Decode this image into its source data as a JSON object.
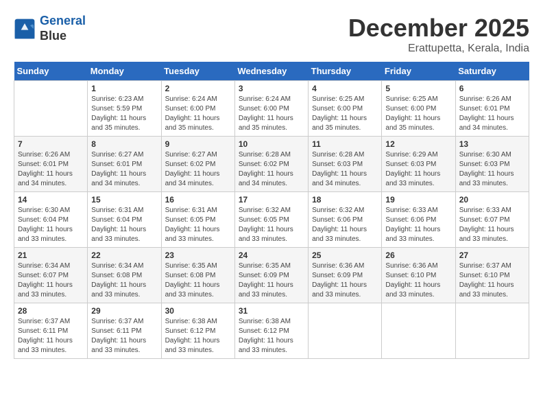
{
  "header": {
    "logo_line1": "General",
    "logo_line2": "Blue",
    "month": "December 2025",
    "location": "Erattupetta, Kerala, India"
  },
  "weekdays": [
    "Sunday",
    "Monday",
    "Tuesday",
    "Wednesday",
    "Thursday",
    "Friday",
    "Saturday"
  ],
  "weeks": [
    [
      {
        "day": "",
        "sunrise": "",
        "sunset": "",
        "daylight": ""
      },
      {
        "day": "1",
        "sunrise": "Sunrise: 6:23 AM",
        "sunset": "Sunset: 5:59 PM",
        "daylight": "Daylight: 11 hours and 35 minutes."
      },
      {
        "day": "2",
        "sunrise": "Sunrise: 6:24 AM",
        "sunset": "Sunset: 6:00 PM",
        "daylight": "Daylight: 11 hours and 35 minutes."
      },
      {
        "day": "3",
        "sunrise": "Sunrise: 6:24 AM",
        "sunset": "Sunset: 6:00 PM",
        "daylight": "Daylight: 11 hours and 35 minutes."
      },
      {
        "day": "4",
        "sunrise": "Sunrise: 6:25 AM",
        "sunset": "Sunset: 6:00 PM",
        "daylight": "Daylight: 11 hours and 35 minutes."
      },
      {
        "day": "5",
        "sunrise": "Sunrise: 6:25 AM",
        "sunset": "Sunset: 6:00 PM",
        "daylight": "Daylight: 11 hours and 35 minutes."
      },
      {
        "day": "6",
        "sunrise": "Sunrise: 6:26 AM",
        "sunset": "Sunset: 6:01 PM",
        "daylight": "Daylight: 11 hours and 34 minutes."
      }
    ],
    [
      {
        "day": "7",
        "sunrise": "Sunrise: 6:26 AM",
        "sunset": "Sunset: 6:01 PM",
        "daylight": "Daylight: 11 hours and 34 minutes."
      },
      {
        "day": "8",
        "sunrise": "Sunrise: 6:27 AM",
        "sunset": "Sunset: 6:01 PM",
        "daylight": "Daylight: 11 hours and 34 minutes."
      },
      {
        "day": "9",
        "sunrise": "Sunrise: 6:27 AM",
        "sunset": "Sunset: 6:02 PM",
        "daylight": "Daylight: 11 hours and 34 minutes."
      },
      {
        "day": "10",
        "sunrise": "Sunrise: 6:28 AM",
        "sunset": "Sunset: 6:02 PM",
        "daylight": "Daylight: 11 hours and 34 minutes."
      },
      {
        "day": "11",
        "sunrise": "Sunrise: 6:28 AM",
        "sunset": "Sunset: 6:03 PM",
        "daylight": "Daylight: 11 hours and 34 minutes."
      },
      {
        "day": "12",
        "sunrise": "Sunrise: 6:29 AM",
        "sunset": "Sunset: 6:03 PM",
        "daylight": "Daylight: 11 hours and 33 minutes."
      },
      {
        "day": "13",
        "sunrise": "Sunrise: 6:30 AM",
        "sunset": "Sunset: 6:03 PM",
        "daylight": "Daylight: 11 hours and 33 minutes."
      }
    ],
    [
      {
        "day": "14",
        "sunrise": "Sunrise: 6:30 AM",
        "sunset": "Sunset: 6:04 PM",
        "daylight": "Daylight: 11 hours and 33 minutes."
      },
      {
        "day": "15",
        "sunrise": "Sunrise: 6:31 AM",
        "sunset": "Sunset: 6:04 PM",
        "daylight": "Daylight: 11 hours and 33 minutes."
      },
      {
        "day": "16",
        "sunrise": "Sunrise: 6:31 AM",
        "sunset": "Sunset: 6:05 PM",
        "daylight": "Daylight: 11 hours and 33 minutes."
      },
      {
        "day": "17",
        "sunrise": "Sunrise: 6:32 AM",
        "sunset": "Sunset: 6:05 PM",
        "daylight": "Daylight: 11 hours and 33 minutes."
      },
      {
        "day": "18",
        "sunrise": "Sunrise: 6:32 AM",
        "sunset": "Sunset: 6:06 PM",
        "daylight": "Daylight: 11 hours and 33 minutes."
      },
      {
        "day": "19",
        "sunrise": "Sunrise: 6:33 AM",
        "sunset": "Sunset: 6:06 PM",
        "daylight": "Daylight: 11 hours and 33 minutes."
      },
      {
        "day": "20",
        "sunrise": "Sunrise: 6:33 AM",
        "sunset": "Sunset: 6:07 PM",
        "daylight": "Daylight: 11 hours and 33 minutes."
      }
    ],
    [
      {
        "day": "21",
        "sunrise": "Sunrise: 6:34 AM",
        "sunset": "Sunset: 6:07 PM",
        "daylight": "Daylight: 11 hours and 33 minutes."
      },
      {
        "day": "22",
        "sunrise": "Sunrise: 6:34 AM",
        "sunset": "Sunset: 6:08 PM",
        "daylight": "Daylight: 11 hours and 33 minutes."
      },
      {
        "day": "23",
        "sunrise": "Sunrise: 6:35 AM",
        "sunset": "Sunset: 6:08 PM",
        "daylight": "Daylight: 11 hours and 33 minutes."
      },
      {
        "day": "24",
        "sunrise": "Sunrise: 6:35 AM",
        "sunset": "Sunset: 6:09 PM",
        "daylight": "Daylight: 11 hours and 33 minutes."
      },
      {
        "day": "25",
        "sunrise": "Sunrise: 6:36 AM",
        "sunset": "Sunset: 6:09 PM",
        "daylight": "Daylight: 11 hours and 33 minutes."
      },
      {
        "day": "26",
        "sunrise": "Sunrise: 6:36 AM",
        "sunset": "Sunset: 6:10 PM",
        "daylight": "Daylight: 11 hours and 33 minutes."
      },
      {
        "day": "27",
        "sunrise": "Sunrise: 6:37 AM",
        "sunset": "Sunset: 6:10 PM",
        "daylight": "Daylight: 11 hours and 33 minutes."
      }
    ],
    [
      {
        "day": "28",
        "sunrise": "Sunrise: 6:37 AM",
        "sunset": "Sunset: 6:11 PM",
        "daylight": "Daylight: 11 hours and 33 minutes."
      },
      {
        "day": "29",
        "sunrise": "Sunrise: 6:37 AM",
        "sunset": "Sunset: 6:11 PM",
        "daylight": "Daylight: 11 hours and 33 minutes."
      },
      {
        "day": "30",
        "sunrise": "Sunrise: 6:38 AM",
        "sunset": "Sunset: 6:12 PM",
        "daylight": "Daylight: 11 hours and 33 minutes."
      },
      {
        "day": "31",
        "sunrise": "Sunrise: 6:38 AM",
        "sunset": "Sunset: 6:12 PM",
        "daylight": "Daylight: 11 hours and 33 minutes."
      },
      {
        "day": "",
        "sunrise": "",
        "sunset": "",
        "daylight": ""
      },
      {
        "day": "",
        "sunrise": "",
        "sunset": "",
        "daylight": ""
      },
      {
        "day": "",
        "sunrise": "",
        "sunset": "",
        "daylight": ""
      }
    ]
  ]
}
